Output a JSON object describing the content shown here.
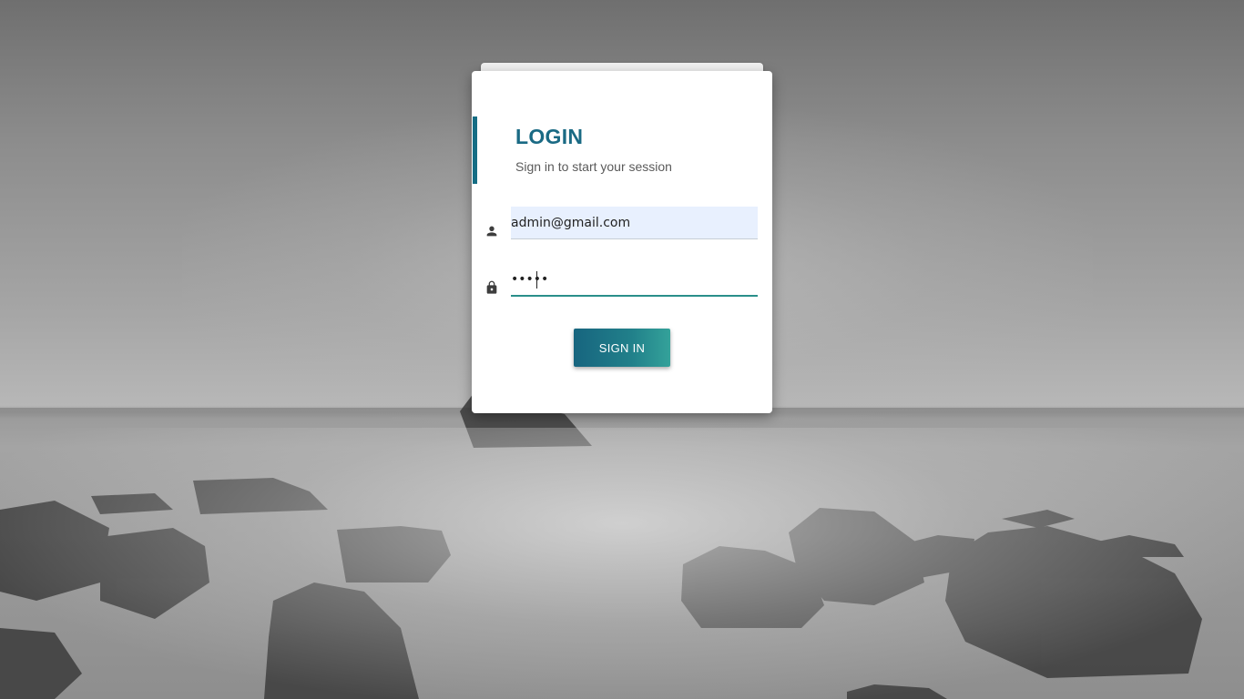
{
  "login": {
    "title": "LOGIN",
    "subtitle": "Sign in to start your session",
    "email_value": "admin@gmail.com",
    "password_value": "•••••",
    "signin_label": "SIGN IN"
  },
  "icons": {
    "email": "person-icon",
    "password": "lock-icon"
  },
  "colors": {
    "accent": "#156d84",
    "button_start": "#17657f",
    "button_end": "#34a29a",
    "autofill_bg": "#e8f0fe"
  }
}
